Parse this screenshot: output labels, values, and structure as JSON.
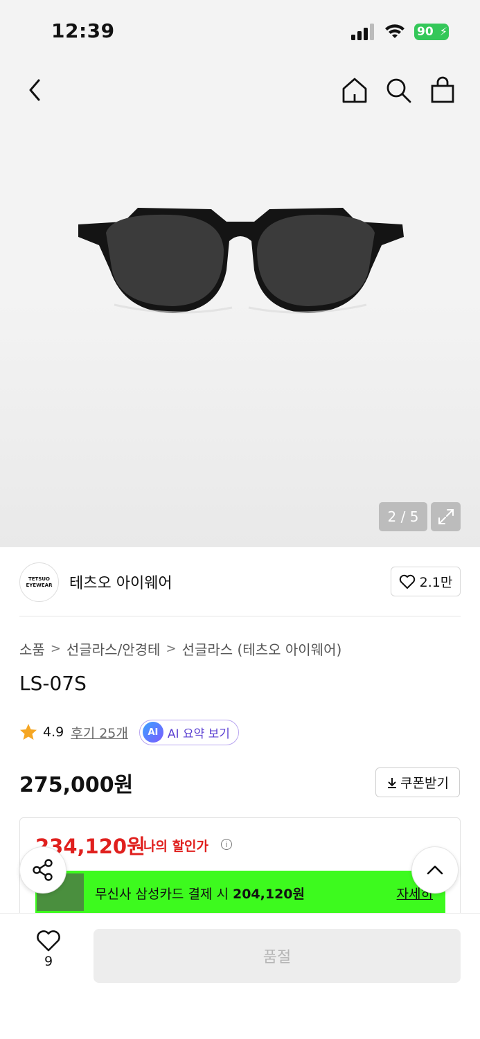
{
  "status_bar": {
    "time": "12:39",
    "battery": "90"
  },
  "gallery": {
    "current": "2",
    "separator": "/",
    "total": "5",
    "counter_text": "2 / 5"
  },
  "brand": {
    "logo_line1": "TETSUO",
    "logo_line2": "EYEWEAR",
    "name": "테츠오 아이웨어",
    "likes": "2.1만"
  },
  "breadcrumb": [
    "소품",
    "선글라스/안경테",
    "선글라스 (테츠오 아이웨어)"
  ],
  "product": {
    "name": "LS-07S",
    "rating": "4.9",
    "review_link": "후기 25개",
    "ai_badge": "AI",
    "ai_summary_label": "AI 요약 보기",
    "price": "275,000원",
    "coupon_label": "쿠폰받기"
  },
  "discount": {
    "price": "234,120원",
    "label": "나의 할인가",
    "card_text_prefix": "무신사 삼성카드 결제 시 ",
    "card_text_amount": "204,120원",
    "card_detail": "자세히"
  },
  "bottom_bar": {
    "wish_count": "9",
    "cta_label": "품절"
  },
  "colors": {
    "discount_red": "#e0201e",
    "card_banner_green": "#3dfa1e",
    "battery_green": "#34c759",
    "ai_purple": "#5a3fd1"
  },
  "icons": [
    "back-icon",
    "home-icon",
    "search-icon",
    "bag-icon",
    "expand-icon",
    "heart-icon",
    "star-icon",
    "download-icon",
    "info-icon",
    "share-icon",
    "chevron-up-icon"
  ]
}
